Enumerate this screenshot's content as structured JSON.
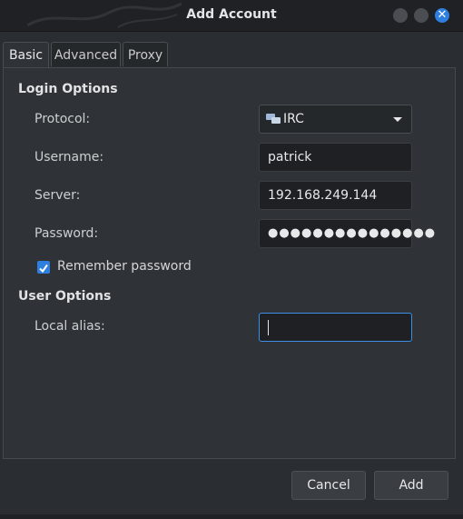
{
  "window": {
    "title": "Add Account"
  },
  "tabs": [
    {
      "label": "Basic"
    },
    {
      "label": "Advanced"
    },
    {
      "label": "Proxy"
    }
  ],
  "login_options": {
    "heading": "Login Options",
    "protocol": {
      "label": "Protocol:",
      "value": "IRC",
      "icon": "irc-chat-icon"
    },
    "username": {
      "label": "Username:",
      "value": "patrick"
    },
    "server": {
      "label": "Server:",
      "value": "192.168.249.144"
    },
    "password": {
      "label": "Password:",
      "value": "●●●●●●●●●●●●●●●"
    },
    "remember_password": {
      "label": "Remember password",
      "checked": true
    }
  },
  "user_options": {
    "heading": "User Options",
    "local_alias": {
      "label": "Local alias:",
      "value": ""
    }
  },
  "buttons": {
    "cancel": "Cancel",
    "add": "Add"
  },
  "colors": {
    "accent": "#2f7fe0",
    "background": "#2a2d31",
    "field_bg": "#1e2023"
  }
}
